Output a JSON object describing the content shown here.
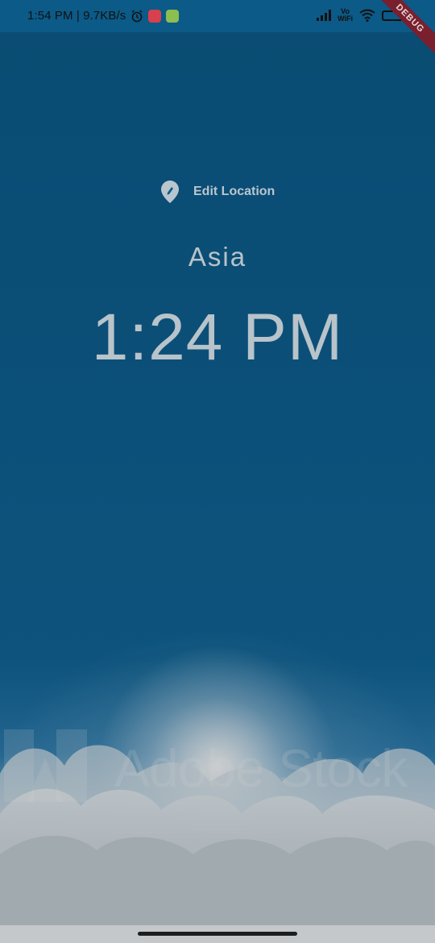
{
  "status_bar": {
    "time_speed": "1:54 PM | 9.7KB/s",
    "vowifi": [
      "Vo",
      "WiFi"
    ],
    "icons": [
      "alarm-icon",
      "tiktok-app-icon",
      "green-app-icon",
      "signal-icon",
      "wifi-icon",
      "battery-icon"
    ]
  },
  "debug_banner": "DEBUG",
  "main": {
    "edit_location_label": "Edit Location",
    "location": "Asia",
    "time": "1:24 PM"
  },
  "background": {
    "watermark": "Adobe Stock",
    "colors": {
      "sky_top": "#0d5d8c",
      "text": "#b8c3ca",
      "debug": "#7a1f2e"
    }
  }
}
